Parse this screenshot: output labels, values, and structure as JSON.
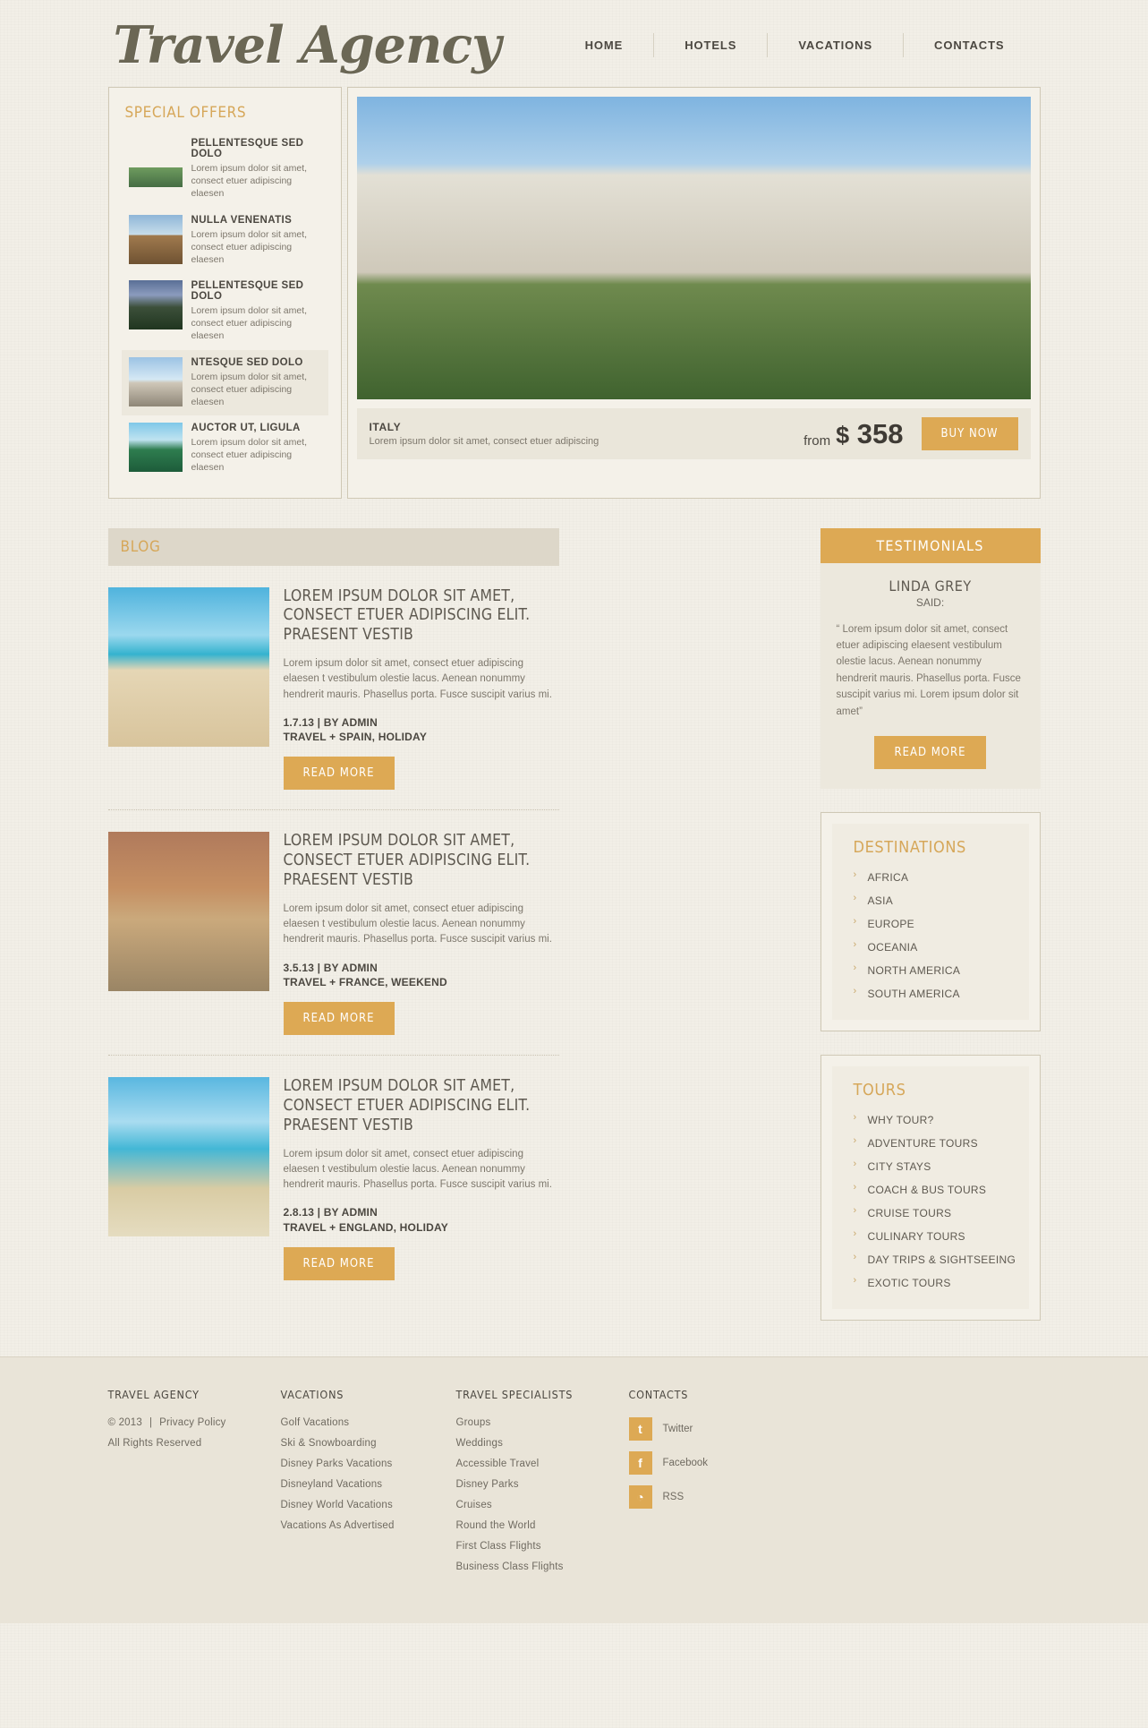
{
  "site": {
    "logo": "Travel Agency"
  },
  "nav": [
    {
      "label": "HOME",
      "active": true
    },
    {
      "label": "HOTELS",
      "active": false
    },
    {
      "label": "VACATIONS",
      "active": false
    },
    {
      "label": "CONTACTS",
      "active": false
    }
  ],
  "special_offers": {
    "title": "SPECIAL OFFERS",
    "items": [
      {
        "title": "PELLENTESQUE SED DOLO",
        "text": "Lorem ipsum dolor sit amet, consect etuer adipiscing elaesen",
        "selected": false,
        "photo": "mountain-hiker-photo"
      },
      {
        "title": "NULLA VENENATIS",
        "text": "Lorem ipsum dolor sit amet, consect etuer adipiscing elaesen",
        "selected": false,
        "photo": "cathedral-photo"
      },
      {
        "title": "PELLENTESQUE SED DOLO",
        "text": "Lorem ipsum dolor sit amet, consect etuer adipiscing elaesen",
        "selected": false,
        "photo": "coastal-village-photo"
      },
      {
        "title": "NTESQUE SED DOLO",
        "text": "Lorem ipsum dolor sit amet, consect etuer adipiscing elaesen",
        "selected": true,
        "photo": "chateau-photo"
      },
      {
        "title": "AUCTOR UT, LIGULA",
        "text": "Lorem ipsum dolor sit amet, consect etuer adipiscing elaesen",
        "selected": false,
        "photo": "waterfall-photo"
      }
    ]
  },
  "hero": {
    "photo": "chateau-de-chenonceau-photo",
    "country": "ITALY",
    "description": "Lorem ipsum dolor sit amet, consect etuer adipiscing",
    "from_label": "from",
    "currency": "$",
    "price": "358",
    "buy_label": "BUY NOW"
  },
  "blog": {
    "title": "BLOG",
    "posts": [
      {
        "photo": "beach-chair-photo",
        "heading": "LOREM IPSUM DOLOR SIT AMET, CONSECT ETUER ADIPISCING ELIT. PRAESENT VESTIB",
        "excerpt": "Lorem ipsum dolor sit amet, consect etuer adipiscing elaesen t vestibulum olestie lacus. Aenean nonummy hendrerit mauris. Phasellus porta. Fusce suscipit varius mi.",
        "date": "1.7.13 | BY ADMIN",
        "tags": "TRAVEL + SPAIN, HOLIDAY",
        "read_more": "READ MORE"
      },
      {
        "photo": "venice-canal-photo",
        "heading": "LOREM IPSUM DOLOR SIT AMET, CONSECT ETUER ADIPISCING ELIT. PRAESENT VESTIB",
        "excerpt": "Lorem ipsum dolor sit amet, consect etuer adipiscing elaesen t vestibulum olestie lacus. Aenean nonummy hendrerit mauris. Phasellus porta. Fusce suscipit varius mi.",
        "date": "3.5.13 | BY ADMIN",
        "tags": "TRAVEL + FRANCE, WEEKEND",
        "read_more": "READ MORE"
      },
      {
        "photo": "longtail-boat-photo",
        "heading": "LOREM IPSUM DOLOR SIT AMET, CONSECT ETUER ADIPISCING ELIT. PRAESENT VESTIB",
        "excerpt": "Lorem ipsum dolor sit amet, consect etuer adipiscing elaesen t vestibulum olestie lacus. Aenean nonummy hendrerit mauris. Phasellus porta. Fusce suscipit varius mi.",
        "date": "2.8.13 | BY ADMIN",
        "tags": "TRAVEL + ENGLAND, HOLIDAY",
        "read_more": "READ MORE"
      }
    ]
  },
  "testimonials": {
    "title": "TESTIMONIALS",
    "author": "LINDA GREY",
    "said_label": "SAID:",
    "quote": "“ Lorem ipsum dolor sit amet, consect etuer adipiscing elaesent vestibulum olestie lacus. Aenean nonummy hendrerit mauris. Phasellus porta. Fusce suscipit varius mi. Lorem ipsum dolor sit amet”",
    "read_more": "READ MORE"
  },
  "destinations": {
    "title": "DESTINATIONS",
    "items": [
      "AFRICA",
      "ASIA",
      "EUROPE",
      "OCEANIA",
      "NORTH AMERICA",
      "SOUTH AMERICA"
    ]
  },
  "tours": {
    "title": "TOURS",
    "items": [
      "WHY TOUR?",
      "ADVENTURE TOURS",
      "CITY STAYS",
      "COACH & BUS TOURS",
      "CRUISE TOURS",
      "CULINARY TOURS",
      "DAY TRIPS & SIGHTSEEING",
      "EXOTIC TOURS"
    ]
  },
  "footer": {
    "col1": {
      "title": "TRAVEL AGENCY",
      "copyright": "© 2013",
      "divider": "|",
      "privacy": "Privacy Policy",
      "rights": "All Rights Reserved"
    },
    "col2": {
      "title": "VACATIONS",
      "links": [
        "Golf Vacations",
        "Ski & Snowboarding",
        "Disney Parks Vacations",
        "Disneyland Vacations",
        "Disney World Vacations",
        "Vacations As Advertised"
      ]
    },
    "col3": {
      "title": "TRAVEL SPECIALISTS",
      "links": [
        "Groups",
        "Weddings",
        "Accessible Travel",
        "Disney Parks",
        "Cruises",
        "Round the World",
        "First Class Flights",
        "Business Class Flights"
      ]
    },
    "col4": {
      "title": "CONTACTS",
      "socials": [
        {
          "label": "Twitter",
          "icon": "twitter-icon",
          "glyph": "t"
        },
        {
          "label": "Facebook",
          "icon": "facebook-icon",
          "glyph": "f"
        },
        {
          "label": "RSS",
          "icon": "rss-icon",
          "glyph": "◔"
        }
      ]
    }
  },
  "colors": {
    "accent": "#dda954",
    "gold": "#d6a759",
    "text": "#5e5950",
    "bg": "#f2efe7"
  }
}
